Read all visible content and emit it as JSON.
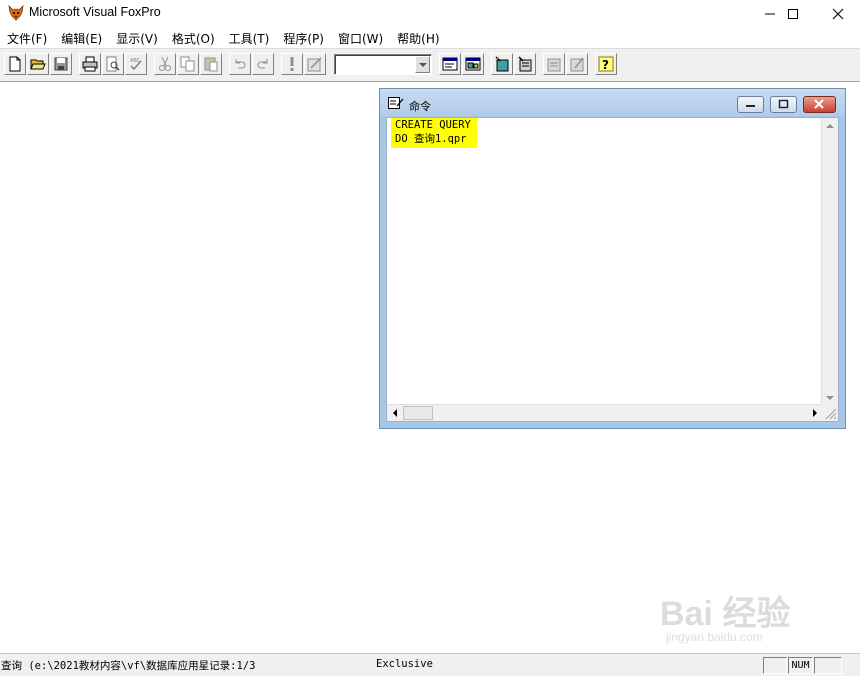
{
  "window": {
    "title": "Microsoft Visual FoxPro"
  },
  "menu": [
    "文件(F)",
    "编辑(E)",
    "显示(V)",
    "格式(O)",
    "工具(T)",
    "程序(P)",
    "窗口(W)",
    "帮助(H)"
  ],
  "toolbar": {
    "buttons": [
      "new-icon",
      "open-icon",
      "save-icon",
      "print-icon",
      "print-preview-icon",
      "spelling-icon",
      "cut-icon",
      "copy-icon",
      "paste-icon",
      "undo-icon",
      "redo-icon",
      "run-icon",
      "modify-form-icon",
      "command-window-icon",
      "data-session-icon",
      "form-wizard-icon",
      "report-wizard-icon",
      "autoform-icon",
      "autoreport-icon",
      "help-icon"
    ],
    "combo_value": ""
  },
  "command_window": {
    "title": "命令",
    "lines": [
      "CREATE QUERY",
      "DO 查询1.qpr"
    ],
    "highlight_color": "#ffff00"
  },
  "status": {
    "text": "查询 (e:\\2021教材内容\\vf\\数据库应用星记录:1/3",
    "mode": "Exclusive",
    "panels": [
      "",
      "NUM",
      ""
    ]
  },
  "watermark": {
    "text": "Bai 经验",
    "sub": "jingyan.baidu.com"
  }
}
